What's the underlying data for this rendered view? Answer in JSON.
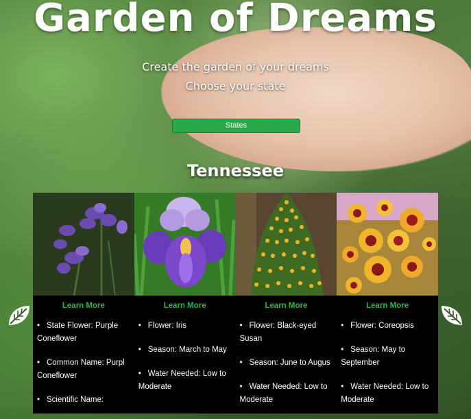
{
  "hero": {
    "title": "Garden of Dreams",
    "tagline": "Create the garden of your dreams",
    "choose": "Choose your state",
    "states_button": "States"
  },
  "state": {
    "name": "Tennessee"
  },
  "cards": [
    {
      "image_alt": "purple coneflower",
      "learn_more": "Learn More",
      "facts": [
        "State Flower: Purple Coneflower",
        "Common Name: Purpl Coneflower",
        "Scientific Name:"
      ]
    },
    {
      "image_alt": "iris",
      "learn_more": "Learn More",
      "facts": [
        "Flower: Iris",
        "Season: March to May",
        "Water Needed: Low to Moderate"
      ]
    },
    {
      "image_alt": "black-eyed susan",
      "learn_more": "Learn More",
      "facts": [
        "Flower: Black-eyed Susan",
        "Season: June to Augus",
        "Water Needed: Low to Moderate"
      ]
    },
    {
      "image_alt": "coreopsis",
      "learn_more": "Learn More",
      "facts": [
        "Flower: Coreopsis",
        "Season: May to September",
        "Water Needed: Low to Moderate"
      ]
    }
  ],
  "icons": {
    "left": "leaf-icon",
    "right": "leaf-icon"
  },
  "colors": {
    "accent": "#2aa84a",
    "link": "#2db34a",
    "card_bg": "#000000"
  }
}
